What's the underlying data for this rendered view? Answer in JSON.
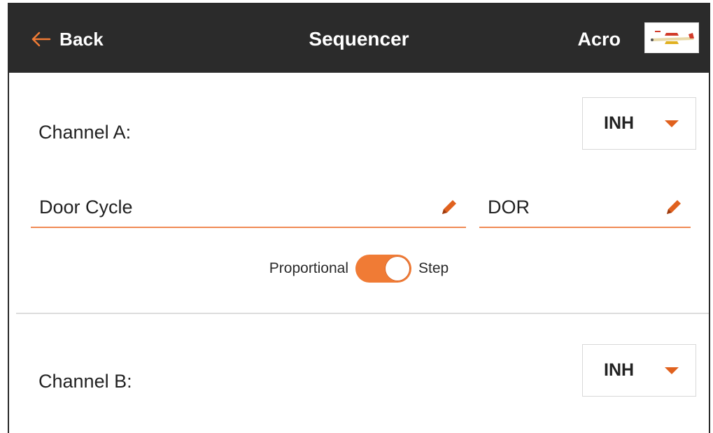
{
  "header": {
    "back_label": "Back",
    "title": "Sequencer",
    "model_name": "Acro"
  },
  "channel_a": {
    "label": "Channel A:",
    "dropdown_value": "INH",
    "name_field": "Door Cycle",
    "short_field": "DOR",
    "toggle_left_label": "Proportional",
    "toggle_right_label": "Step",
    "toggle_state": "Step"
  },
  "channel_b": {
    "label": "Channel B:",
    "dropdown_value": "INH"
  },
  "colors": {
    "accent": "#f07b35",
    "header_bg": "#2b2b2b"
  },
  "icons": {
    "back": "arrow-left-icon",
    "edit": "pencil-icon",
    "dropdown": "caret-down-icon"
  }
}
